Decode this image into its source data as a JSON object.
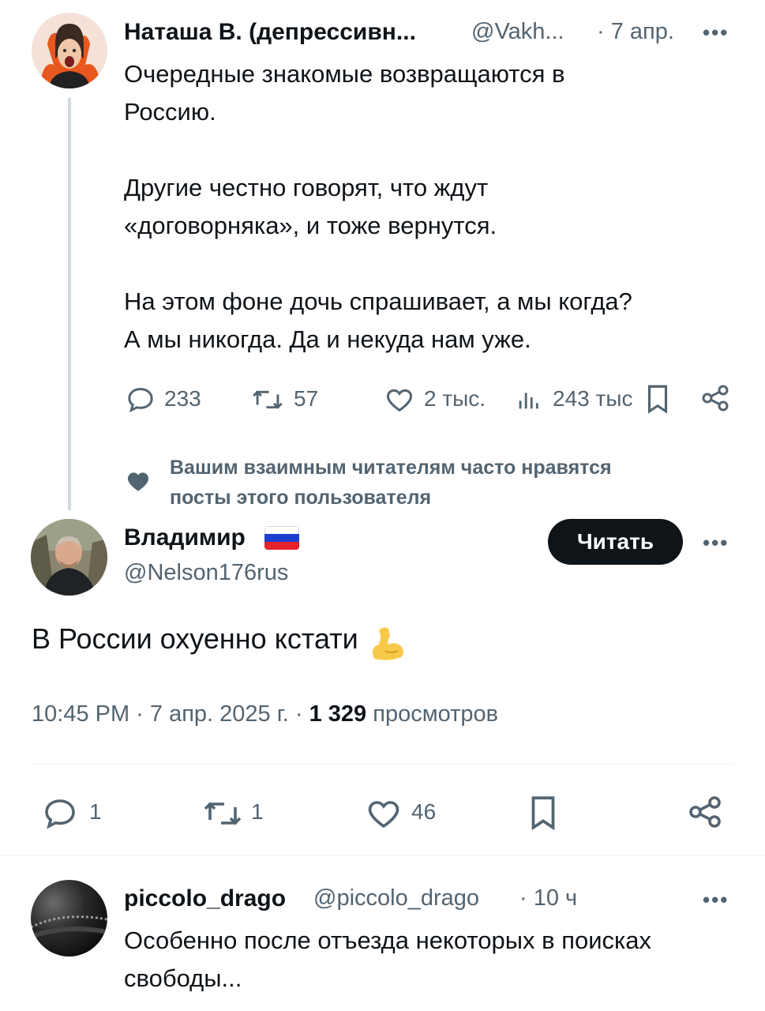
{
  "tweet1": {
    "author": "Наташа В. (депрессивн...",
    "handle": "@Vakh...",
    "time": "· 7 апр.",
    "text": "Очередные знакомые возвращаются в\nРоссию.\n\nДругие честно говорят, что ждут\n«договорняка», и тоже вернутся.\n\nНа этом фоне дочь спрашивает, а мы когда?\nА мы никогда. Да и некуда нам уже.",
    "replies": "233",
    "retweets": "57",
    "likes": "2 тыс.",
    "views": "243 тыс"
  },
  "mutual_note": "Вашим взаимным читателям часто нравятся\nпосты этого пользователя",
  "main_tweet": {
    "author": "Владимир",
    "handle": "@Nelson176rus",
    "follow_label": "Читать",
    "text": "В России охуенно кстати",
    "time": "10:45 PM · 7 апр. 2025 г. · ",
    "views_count": "1 329",
    "views_label": " просмотров",
    "replies": "1",
    "retweets": "1",
    "likes": "46"
  },
  "reply": {
    "author": "piccolo_drago",
    "handle": "@piccolo_drago",
    "time": "· 10 ч",
    "text": "Особенно после отъезда некоторых в поисках\nсвободы..."
  },
  "icons": {
    "reply": "reply-icon",
    "retweet": "retweet-icon",
    "like": "heart-icon",
    "views": "views-icon",
    "bookmark": "bookmark-icon",
    "share": "share-icon",
    "more": "more-icon",
    "flag": "russia-flag-icon",
    "emoji": "flexed-biceps-icon",
    "mutual": "heart-filled-icon"
  },
  "colors": {
    "text": "#0f1419",
    "muted": "#536471",
    "follow_bg": "#0f1419",
    "thread_line": "#cfd9de"
  }
}
